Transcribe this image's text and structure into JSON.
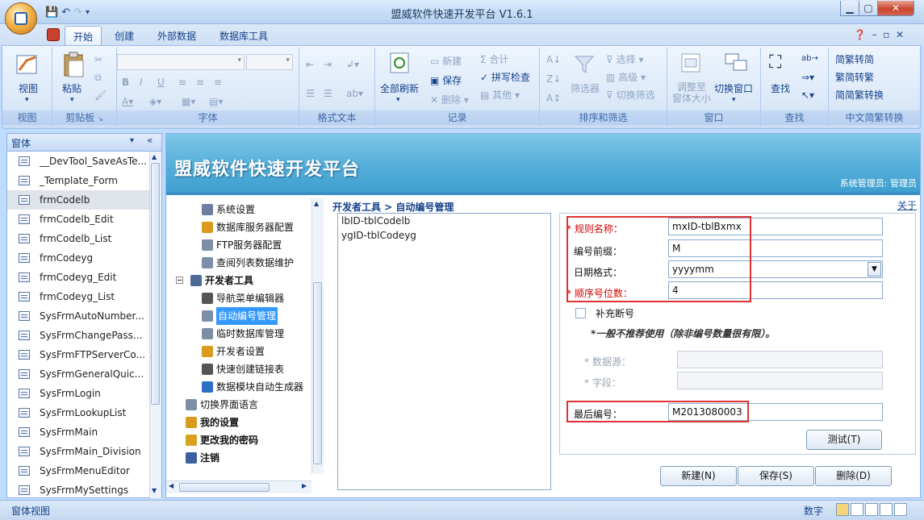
{
  "window": {
    "title": "盟威软件快速开发平台 V1.6.1"
  },
  "ribbon": {
    "tabs": [
      "开始",
      "创建",
      "外部数据",
      "数据库工具"
    ],
    "groups": {
      "view": {
        "label": "视图",
        "btn": "视图"
      },
      "clipboard": {
        "label": "剪贴板",
        "paste": "粘贴"
      },
      "font": {
        "label": "字体"
      },
      "richtext": {
        "label": "格式文本"
      },
      "records": {
        "label": "记录",
        "refresh": "全部刷新",
        "new": "新建",
        "save": "保存",
        "delete": "删除",
        "totals": "合计",
        "spelling": "拼写检查",
        "more": "其他"
      },
      "sort": {
        "label": "排序和筛选",
        "filter": "筛选器",
        "selection": "选择",
        "advanced": "高级",
        "toggle": "切换筛选"
      },
      "window": {
        "label": "窗口",
        "fit": "调整至\n窗体大小",
        "switch": "切换窗口"
      },
      "find": {
        "label": "查找",
        "find": "查找"
      },
      "chinese": {
        "label": "中文简繁转换",
        "t2s": "繁转简",
        "s2t": "简转繁",
        "conv": "简繁转换"
      }
    }
  },
  "nav": {
    "title": "窗体",
    "items": [
      "__DevTool_SaveAsTe...",
      "_Template_Form",
      "frmCodelb",
      "frmCodelb_Edit",
      "frmCodelb_List",
      "frmCodeyg",
      "frmCodeyg_Edit",
      "frmCodeyg_List",
      "SysFrmAutoNumber...",
      "SysFrmChangePass...",
      "SysFrmFTPServerCo...",
      "SysFrmGeneralQuic...",
      "SysFrmLogin",
      "SysFrmLookupList",
      "SysFrmMain",
      "SysFrmMain_Division",
      "SysFrmMenuEditor",
      "SysFrmMySettings"
    ]
  },
  "banner": {
    "title": "盟威软件快速开发平台",
    "user": "系统管理员: 管理员"
  },
  "tree": {
    "items": [
      "系统设置",
      "数据库服务器配置",
      "FTP服务器配置",
      "查阅列表数据维护",
      "开发者工具",
      "导航菜单编辑器",
      "自动编号管理",
      "临时数据库管理",
      "开发者设置",
      "快速创建链接表",
      "数据模块自动生成器",
      "切换界面语言",
      "我的设置",
      "更改我的密码",
      "注销"
    ]
  },
  "crumb": "开发者工具 > 自动编号管理",
  "close_link": "关于",
  "rules": [
    "lbID-tblCodelb",
    "ygID-tblCodeyg"
  ],
  "form": {
    "rule_name_label": "规则名称：",
    "rule_name": "mxID-tblBxmx",
    "prefix_label": "编号前缀：",
    "prefix": "M",
    "date_label": "日期格式：",
    "date": "yyyymm",
    "seq_label": "顺序号位数：",
    "seq": "4",
    "fill_label": "补充断号",
    "note": "*一般不推荐使用（除非编号数量很有限）。",
    "source_label": "* 数据源：",
    "field_label": "* 字段：",
    "last_label": "最后编号：",
    "last": "M2013080003",
    "test_btn": "测试(T)",
    "new_btn": "新建(N)",
    "save_btn": "保存(S)",
    "delete_btn": "删除(D)"
  },
  "status": {
    "left": "窗体视图",
    "right": "数字"
  }
}
